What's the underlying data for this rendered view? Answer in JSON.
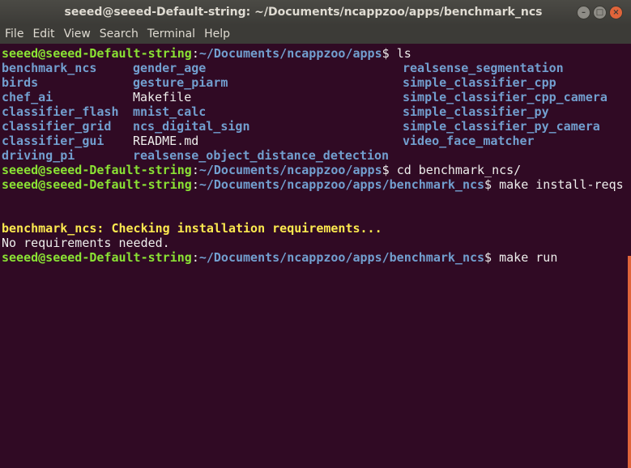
{
  "window": {
    "title": "seeed@seeed-Default-string: ~/Documents/ncappzoo/apps/benchmark_ncs",
    "buttons": {
      "minimize": "–",
      "maximize": "□",
      "close": "×"
    }
  },
  "menu": [
    "File",
    "Edit",
    "View",
    "Search",
    "Terminal",
    "Help"
  ],
  "prompt": {
    "user": "seeed@seeed-Default-string",
    "sep": ":",
    "path_apps": "~/Documents/ncappzoo/apps",
    "path_bench": "~/Documents/ncappzoo/apps/benchmark_ncs",
    "dollar": "$ "
  },
  "commands": {
    "ls": "ls",
    "cd": "cd benchmark_ncs/",
    "make_install": "make install-reqs",
    "make_run": "make run"
  },
  "listing": {
    "col1": [
      "benchmark_ncs",
      "birds",
      "chef_ai",
      "classifier_flash",
      "classifier_grid",
      "classifier_gui",
      "driving_pi"
    ],
    "col2": [
      "gender_age",
      "gesture_piarm",
      "Makefile",
      "mnist_calc",
      "ncs_digital_sign",
      "README.md",
      "realsense_object_distance_detection"
    ],
    "col3": [
      "realsense_segmentation",
      "simple_classifier_cpp",
      "simple_classifier_cpp_camera",
      "simple_classifier_py",
      "simple_classifier_py_camera",
      "video_face_matcher"
    ]
  },
  "output": {
    "checking": "benchmark_ncs: Checking installation requirements...",
    "no_reqs": "No requirements needed."
  },
  "colors": {
    "background": "#300a24",
    "prompt_user": "#8ae234",
    "prompt_path": "#729fcf",
    "warning": "#fce94f",
    "scrollbar": "#e0643a"
  }
}
